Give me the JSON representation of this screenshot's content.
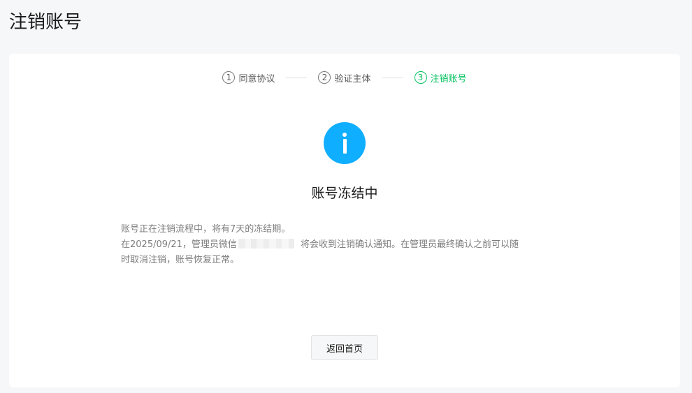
{
  "header": {
    "title": "注销账号"
  },
  "steps": [
    {
      "num": "1",
      "label": "同意协议",
      "active": false
    },
    {
      "num": "2",
      "label": "验证主体",
      "active": false
    },
    {
      "num": "3",
      "label": "注销账号",
      "active": true
    }
  ],
  "status": {
    "icon": "info-icon",
    "icon_color": "#10aeff",
    "title": "账号冻结中"
  },
  "description": {
    "line1": "账号正在注销流程中，将有7天的冻结期。",
    "line2_before": "在2025/09/21，管理员微信",
    "line2_after": "将会收到注销确认通知。在管理员最终确认之前可以随",
    "line3": "时取消注销，账号恢复正常。"
  },
  "actions": {
    "home_label": "返回首页"
  },
  "colors": {
    "active_step": "#07c160",
    "background": "#f6f7f9"
  }
}
